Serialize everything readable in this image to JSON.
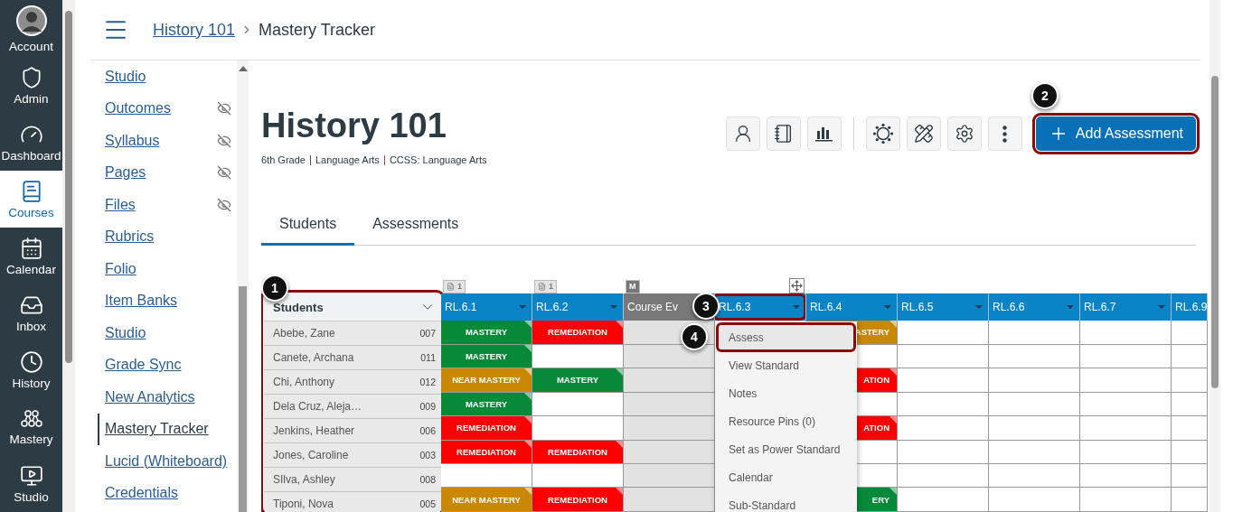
{
  "global_nav": [
    {
      "label": "Account",
      "kind": "account",
      "selected": false
    },
    {
      "label": "Admin",
      "kind": "admin",
      "selected": false
    },
    {
      "label": "Dashboard",
      "kind": "dashboard",
      "selected": false
    },
    {
      "label": "Courses",
      "kind": "courses",
      "selected": true
    },
    {
      "label": "Calendar",
      "kind": "calendar",
      "selected": false
    },
    {
      "label": "Inbox",
      "kind": "inbox",
      "selected": false
    },
    {
      "label": "History",
      "kind": "history",
      "selected": false
    },
    {
      "label": "Mastery",
      "kind": "mastery",
      "selected": false
    },
    {
      "label": "Studio",
      "kind": "studio",
      "selected": false
    }
  ],
  "breadcrumb": [
    {
      "label": "History 101",
      "current": false
    },
    {
      "label": "Mastery Tracker",
      "current": true
    }
  ],
  "course_nav": [
    {
      "label": "Studio",
      "hidden": false,
      "selected": false
    },
    {
      "label": "Outcomes",
      "hidden": true,
      "selected": false
    },
    {
      "label": "Syllabus",
      "hidden": true,
      "selected": false
    },
    {
      "label": "Pages",
      "hidden": true,
      "selected": false
    },
    {
      "label": "Files",
      "hidden": true,
      "selected": false
    },
    {
      "label": "Rubrics",
      "hidden": false,
      "selected": false
    },
    {
      "label": "Folio",
      "hidden": false,
      "selected": false
    },
    {
      "label": "Item Banks",
      "hidden": false,
      "selected": false
    },
    {
      "label": "Studio",
      "hidden": false,
      "selected": false
    },
    {
      "label": "Grade Sync",
      "hidden": false,
      "selected": false
    },
    {
      "label": "New Analytics",
      "hidden": false,
      "selected": false
    },
    {
      "label": "Mastery Tracker",
      "hidden": false,
      "selected": true
    },
    {
      "label": "Lucid (Whiteboard)",
      "hidden": false,
      "selected": false
    },
    {
      "label": "Credentials",
      "hidden": false,
      "selected": false
    }
  ],
  "page": {
    "title": "History 101",
    "meta": [
      "6th Grade",
      "Language Arts",
      "CCSS: Language Arts"
    ]
  },
  "primary_action": {
    "label": "Add Assessment",
    "callout": "2"
  },
  "tabs": [
    {
      "label": "Students",
      "selected": true
    },
    {
      "label": "Assessments",
      "selected": false
    }
  ],
  "grid": {
    "students_header": {
      "label": "Students",
      "callout": "1"
    },
    "columns": [
      {
        "label": "RL.6.1",
        "kind": "standard",
        "badge": {
          "kind": "note",
          "text": "1"
        }
      },
      {
        "label": "RL.6.2",
        "kind": "standard",
        "badge": {
          "kind": "note",
          "text": "1"
        }
      },
      {
        "label": "Course Ev",
        "kind": "course",
        "badge": {
          "kind": "mark",
          "text": "M"
        }
      },
      {
        "label": "RL.6.3",
        "kind": "standard",
        "callout": "3",
        "badge": {
          "kind": "move"
        },
        "menu": {
          "items": [
            {
              "label": "Assess",
              "selected": true,
              "callout": "4"
            },
            {
              "label": "View Standard",
              "selected": false
            },
            {
              "label": "Notes",
              "selected": false
            },
            {
              "label": "Resource Pins (0)",
              "selected": false
            },
            {
              "label": "Set as Power Standard",
              "selected": false
            },
            {
              "label": "Calendar",
              "selected": false
            },
            {
              "label": "Sub-Standard",
              "selected": false
            }
          ]
        }
      },
      {
        "label": "RL.6.4",
        "kind": "standard"
      },
      {
        "label": "RL.6.5",
        "kind": "standard"
      },
      {
        "label": "RL.6.6",
        "kind": "standard"
      },
      {
        "label": "RL.6.7",
        "kind": "standard"
      },
      {
        "label": "RL.6.9",
        "kind": "standard"
      }
    ],
    "rows": [
      {
        "name": "Abebe, Zane",
        "id": "007",
        "cells": [
          {
            "kind": "mastery",
            "text": "MASTERY"
          },
          {
            "kind": "remediation",
            "text": "REMEDIATION"
          },
          {
            "kind": "course"
          },
          {
            "kind": "covered"
          },
          {
            "kind": "near",
            "text": "ASTERY"
          },
          {
            "kind": "empty"
          },
          {
            "kind": "empty"
          },
          {
            "kind": "empty"
          },
          {
            "kind": "empty"
          }
        ]
      },
      {
        "name": "Canete, Archana",
        "id": "011",
        "cells": [
          {
            "kind": "mastery",
            "text": "MASTERY"
          },
          {
            "kind": "empty"
          },
          {
            "kind": "course"
          },
          {
            "kind": "covered"
          },
          {
            "kind": "empty"
          },
          {
            "kind": "empty"
          },
          {
            "kind": "empty"
          },
          {
            "kind": "empty"
          },
          {
            "kind": "empty"
          }
        ]
      },
      {
        "name": "Chi, Anthony",
        "id": "012",
        "cells": [
          {
            "kind": "near",
            "text": "NEAR MASTERY"
          },
          {
            "kind": "mastery",
            "text": "MASTERY"
          },
          {
            "kind": "course"
          },
          {
            "kind": "covered"
          },
          {
            "kind": "remediation",
            "text": "ATION"
          },
          {
            "kind": "empty"
          },
          {
            "kind": "empty"
          },
          {
            "kind": "empty"
          },
          {
            "kind": "empty"
          }
        ]
      },
      {
        "name": "Dela Cruz, Aleja…",
        "id": "009",
        "cells": [
          {
            "kind": "mastery",
            "text": "MASTERY"
          },
          {
            "kind": "empty"
          },
          {
            "kind": "course"
          },
          {
            "kind": "covered"
          },
          {
            "kind": "empty"
          },
          {
            "kind": "empty"
          },
          {
            "kind": "empty"
          },
          {
            "kind": "empty"
          },
          {
            "kind": "empty"
          }
        ]
      },
      {
        "name": "Jenkins, Heather",
        "id": "006",
        "cells": [
          {
            "kind": "remediation",
            "text": "REMEDIATION"
          },
          {
            "kind": "empty"
          },
          {
            "kind": "course"
          },
          {
            "kind": "covered"
          },
          {
            "kind": "remediation",
            "text": "ATION"
          },
          {
            "kind": "empty"
          },
          {
            "kind": "empty"
          },
          {
            "kind": "empty"
          },
          {
            "kind": "empty"
          }
        ]
      },
      {
        "name": "Jones, Caroline",
        "id": "003",
        "cells": [
          {
            "kind": "remediation",
            "text": "REMEDIATION"
          },
          {
            "kind": "remediation",
            "text": "REMEDIATION"
          },
          {
            "kind": "course"
          },
          {
            "kind": "covered"
          },
          {
            "kind": "empty"
          },
          {
            "kind": "empty"
          },
          {
            "kind": "empty"
          },
          {
            "kind": "empty"
          },
          {
            "kind": "empty"
          }
        ]
      },
      {
        "name": "SIlva, Ashley",
        "id": "008",
        "cells": [
          {
            "kind": "empty"
          },
          {
            "kind": "empty"
          },
          {
            "kind": "course"
          },
          {
            "kind": "covered"
          },
          {
            "kind": "empty"
          },
          {
            "kind": "empty"
          },
          {
            "kind": "empty"
          },
          {
            "kind": "empty"
          },
          {
            "kind": "empty"
          }
        ]
      },
      {
        "name": "Tiponi, Nova",
        "id": "005",
        "cells": [
          {
            "kind": "near",
            "text": "NEAR MASTERY"
          },
          {
            "kind": "remediation",
            "text": "REMEDIATION"
          },
          {
            "kind": "course"
          },
          {
            "kind": "covered"
          },
          {
            "kind": "mastery",
            "text": "ERY"
          },
          {
            "kind": "empty"
          },
          {
            "kind": "empty"
          },
          {
            "kind": "empty"
          },
          {
            "kind": "empty"
          }
        ]
      }
    ]
  }
}
